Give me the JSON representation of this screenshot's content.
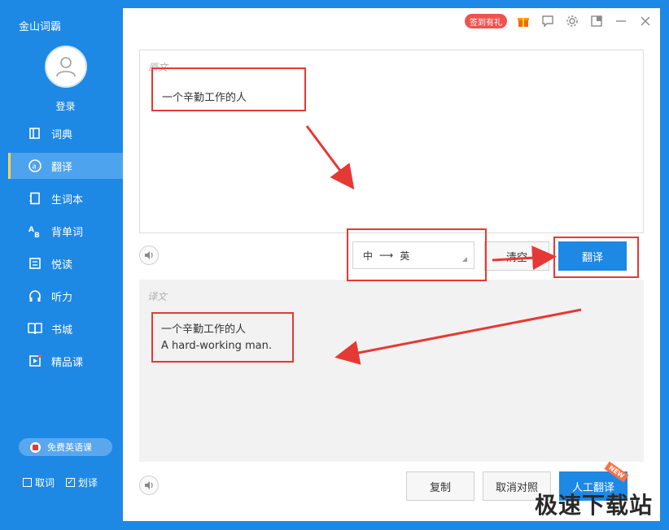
{
  "app": {
    "title": "金山词霸"
  },
  "user": {
    "login_label": "登录"
  },
  "sidebar": {
    "items": [
      {
        "label": "词典",
        "icon": "dictionary-icon"
      },
      {
        "label": "翻译",
        "icon": "translate-icon",
        "active": true
      },
      {
        "label": "生词本",
        "icon": "wordbook-icon"
      },
      {
        "label": "背单词",
        "icon": "ab-icon"
      },
      {
        "label": "悦读",
        "icon": "reading-icon"
      },
      {
        "label": "听力",
        "icon": "headphones-icon"
      },
      {
        "label": "书城",
        "icon": "book-icon"
      },
      {
        "label": "精品课",
        "icon": "course-icon"
      }
    ],
    "promo_label": "免费英语课",
    "check_quword": "取词",
    "check_huayi": "划译",
    "check_huayi_checked": true,
    "check_quword_checked": false
  },
  "topbar": {
    "badge": "签到有礼"
  },
  "source": {
    "label": "原文",
    "text": "一个辛勤工作的人"
  },
  "lang": {
    "from": "中",
    "arrow": "⟶",
    "to": "英"
  },
  "buttons": {
    "clear": "清空",
    "translate": "翻译",
    "copy": "复制",
    "cancel_compare": "取消对照",
    "human_translate": "人工翻译",
    "new_tag": "NEW"
  },
  "target": {
    "label": "译文",
    "line1": "一个辛勤工作的人",
    "line2": "A hard-working man."
  },
  "watermark": "极速下载站",
  "colors": {
    "brand": "#1e88e5",
    "annotation": "#e53935",
    "badge": "#ef5350"
  }
}
